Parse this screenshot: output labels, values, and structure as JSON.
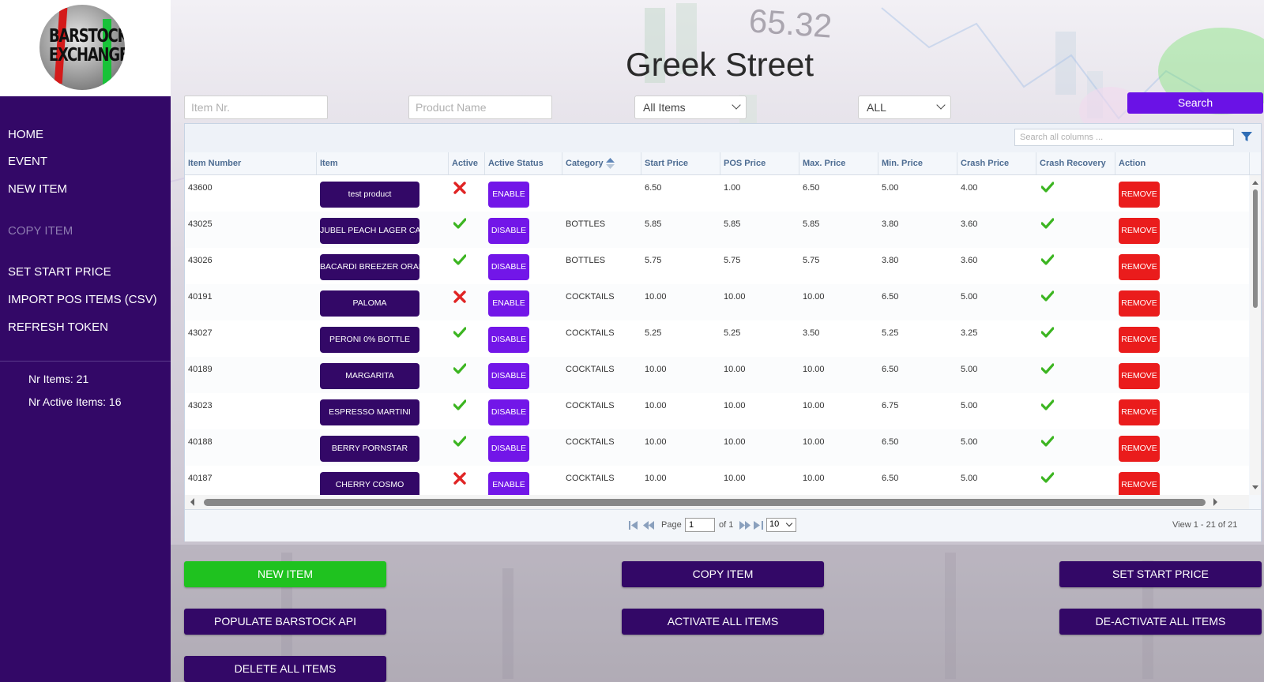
{
  "logo": {
    "line1": "BARSTOCK",
    "line2": "EXCHANGE"
  },
  "sidebar": {
    "items": [
      {
        "label": "HOME",
        "enabled": true
      },
      {
        "label": "EVENT",
        "enabled": true
      },
      {
        "label": "NEW ITEM",
        "enabled": true
      },
      {
        "label": "COPY ITEM",
        "enabled": false
      },
      {
        "label": "SET START PRICE",
        "enabled": true
      },
      {
        "label": "IMPORT POS ITEMS (CSV)",
        "enabled": true
      },
      {
        "label": "REFRESH TOKEN",
        "enabled": true
      }
    ],
    "stats": {
      "nr_items": "Nr Items: 21",
      "nr_active": "Nr Active Items: 16"
    }
  },
  "header": {
    "title": "Greek Street"
  },
  "filters": {
    "item_nr_placeholder": "Item Nr.",
    "product_name_placeholder": "Product Name",
    "item_scope": "All Items",
    "category_scope": "ALL",
    "search_label": "Search"
  },
  "grid": {
    "search_placeholder": "Search all columns ...",
    "columns": [
      "Item Number",
      "Item",
      "Active",
      "Active Status",
      "Category",
      "Start Price",
      "POS Price",
      "Max. Price",
      "Min. Price",
      "Crash Price",
      "Crash Recovery",
      "Action"
    ],
    "sorted_column": "Category",
    "rows": [
      {
        "number": "43600",
        "item": "test product",
        "active": false,
        "status": "ENABLE",
        "category": "",
        "start": "6.50",
        "pos": "1.00",
        "max": "6.50",
        "min": "5.00",
        "crash": "4.00",
        "recovery": true,
        "action": "REMOVE"
      },
      {
        "number": "43025",
        "item": "JUBEL PEACH LAGER CAN",
        "active": true,
        "status": "DISABLE",
        "category": "BOTTLES",
        "start": "5.85",
        "pos": "5.85",
        "max": "5.85",
        "min": "3.80",
        "crash": "3.60",
        "recovery": true,
        "action": "REMOVE"
      },
      {
        "number": "43026",
        "item": "BACARDI BREEZER ORANGE",
        "active": true,
        "status": "DISABLE",
        "category": "BOTTLES",
        "start": "5.75",
        "pos": "5.75",
        "max": "5.75",
        "min": "3.80",
        "crash": "3.60",
        "recovery": true,
        "action": "REMOVE"
      },
      {
        "number": "40191",
        "item": "PALOMA",
        "active": false,
        "status": "ENABLE",
        "category": "COCKTAILS",
        "start": "10.00",
        "pos": "10.00",
        "max": "10.00",
        "min": "6.50",
        "crash": "5.00",
        "recovery": true,
        "action": "REMOVE"
      },
      {
        "number": "43027",
        "item": "PERONI 0% BOTTLE",
        "active": true,
        "status": "DISABLE",
        "category": "COCKTAILS",
        "start": "5.25",
        "pos": "5.25",
        "max": "3.50",
        "min": "5.25",
        "crash": "3.25",
        "recovery": true,
        "action": "REMOVE"
      },
      {
        "number": "40189",
        "item": "MARGARITA",
        "active": true,
        "status": "DISABLE",
        "category": "COCKTAILS",
        "start": "10.00",
        "pos": "10.00",
        "max": "10.00",
        "min": "6.50",
        "crash": "5.00",
        "recovery": true,
        "action": "REMOVE"
      },
      {
        "number": "43023",
        "item": "ESPRESSO MARTINI",
        "active": true,
        "status": "DISABLE",
        "category": "COCKTAILS",
        "start": "10.00",
        "pos": "10.00",
        "max": "10.00",
        "min": "6.75",
        "crash": "5.00",
        "recovery": true,
        "action": "REMOVE"
      },
      {
        "number": "40188",
        "item": "BERRY PORNSTAR",
        "active": true,
        "status": "DISABLE",
        "category": "COCKTAILS",
        "start": "10.00",
        "pos": "10.00",
        "max": "10.00",
        "min": "6.50",
        "crash": "5.00",
        "recovery": true,
        "action": "REMOVE"
      },
      {
        "number": "40187",
        "item": "CHERRY COSMO",
        "active": false,
        "status": "ENABLE",
        "category": "COCKTAILS",
        "start": "10.00",
        "pos": "10.00",
        "max": "10.00",
        "min": "6.50",
        "crash": "5.00",
        "recovery": true,
        "action": "REMOVE"
      }
    ],
    "pager": {
      "page_label": "Page",
      "page_value": "1",
      "of_label": "of 1",
      "rows_per_page": "10",
      "view_text": "View 1 - 21 of 21"
    }
  },
  "buttons": {
    "new_item": "NEW ITEM",
    "copy_item": "COPY ITEM",
    "set_start_price": "SET START PRICE",
    "populate_api": "POPULATE BARSTOCK API",
    "activate_all": "ACTIVATE ALL ITEMS",
    "deactivate_all": "DE-ACTIVATE ALL ITEMS",
    "delete_all": "DELETE ALL ITEMS"
  },
  "background": {
    "ticker_value": "65.32"
  },
  "colors": {
    "sidebar": "#330867",
    "accent_purple": "#7216e8",
    "remove_red": "#ea1c1c",
    "new_green": "#1fc21f",
    "check_green": "#3cb521",
    "cross_red": "#e02424"
  }
}
